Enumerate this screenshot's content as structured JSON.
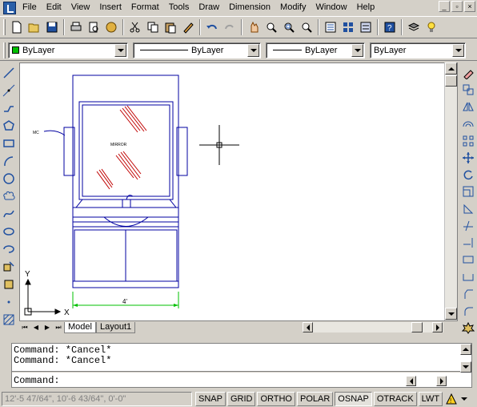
{
  "menu": {
    "items": [
      "File",
      "Edit",
      "View",
      "Insert",
      "Format",
      "Tools",
      "Draw",
      "Dimension",
      "Modify",
      "Window",
      "Help"
    ]
  },
  "window_controls": {
    "minimize": "_",
    "restore": "▫",
    "close": "×"
  },
  "toolbar_standard": {
    "buttons": [
      "new-icon",
      "open-icon",
      "save-icon",
      "print-icon",
      "print-preview-icon",
      "publish-icon",
      "cut-icon",
      "copy-icon",
      "paste-icon",
      "match-properties-icon",
      "undo-icon",
      "redo-icon",
      "pan-icon",
      "zoom-realtime-icon",
      "zoom-window-icon",
      "zoom-previous-icon",
      "properties-icon",
      "design-center-icon",
      "tool-palettes-icon",
      "help-icon",
      "layer-manager-icon",
      "layer-light-icon"
    ]
  },
  "toolbar_properties": {
    "color": "ByLayer",
    "linetype": "ByLayer",
    "lineweight": "ByLayer",
    "plotstyle": "ByLayer",
    "color_swatch": "#00c000"
  },
  "drawing": {
    "labels": {
      "mirror": "MIRROR",
      "mc": "MC",
      "dimension": "4'",
      "ucs_x": "X",
      "ucs_y": "Y"
    },
    "colors": {
      "linework": "#0000a0",
      "hatch": "#c00000",
      "dimension": "#00c000",
      "label": "#000000"
    }
  },
  "layout_tabs": {
    "tabs": [
      "Model",
      "Layout1"
    ],
    "active": "Model"
  },
  "command_window": {
    "history": [
      "Command: *Cancel*",
      "Command: *Cancel*"
    ],
    "prompt": "Command:"
  },
  "status_bar": {
    "coordinates": "12'-5 47/64\", 10'-6 43/64\", 0'-0\"",
    "toggles": [
      {
        "label": "SNAP",
        "on": false
      },
      {
        "label": "GRID",
        "on": false
      },
      {
        "label": "ORTHO",
        "on": false
      },
      {
        "label": "POLAR",
        "on": false
      },
      {
        "label": "OSNAP",
        "on": true
      },
      {
        "label": "OTRACK",
        "on": false
      },
      {
        "label": "LWT",
        "on": false
      }
    ]
  }
}
